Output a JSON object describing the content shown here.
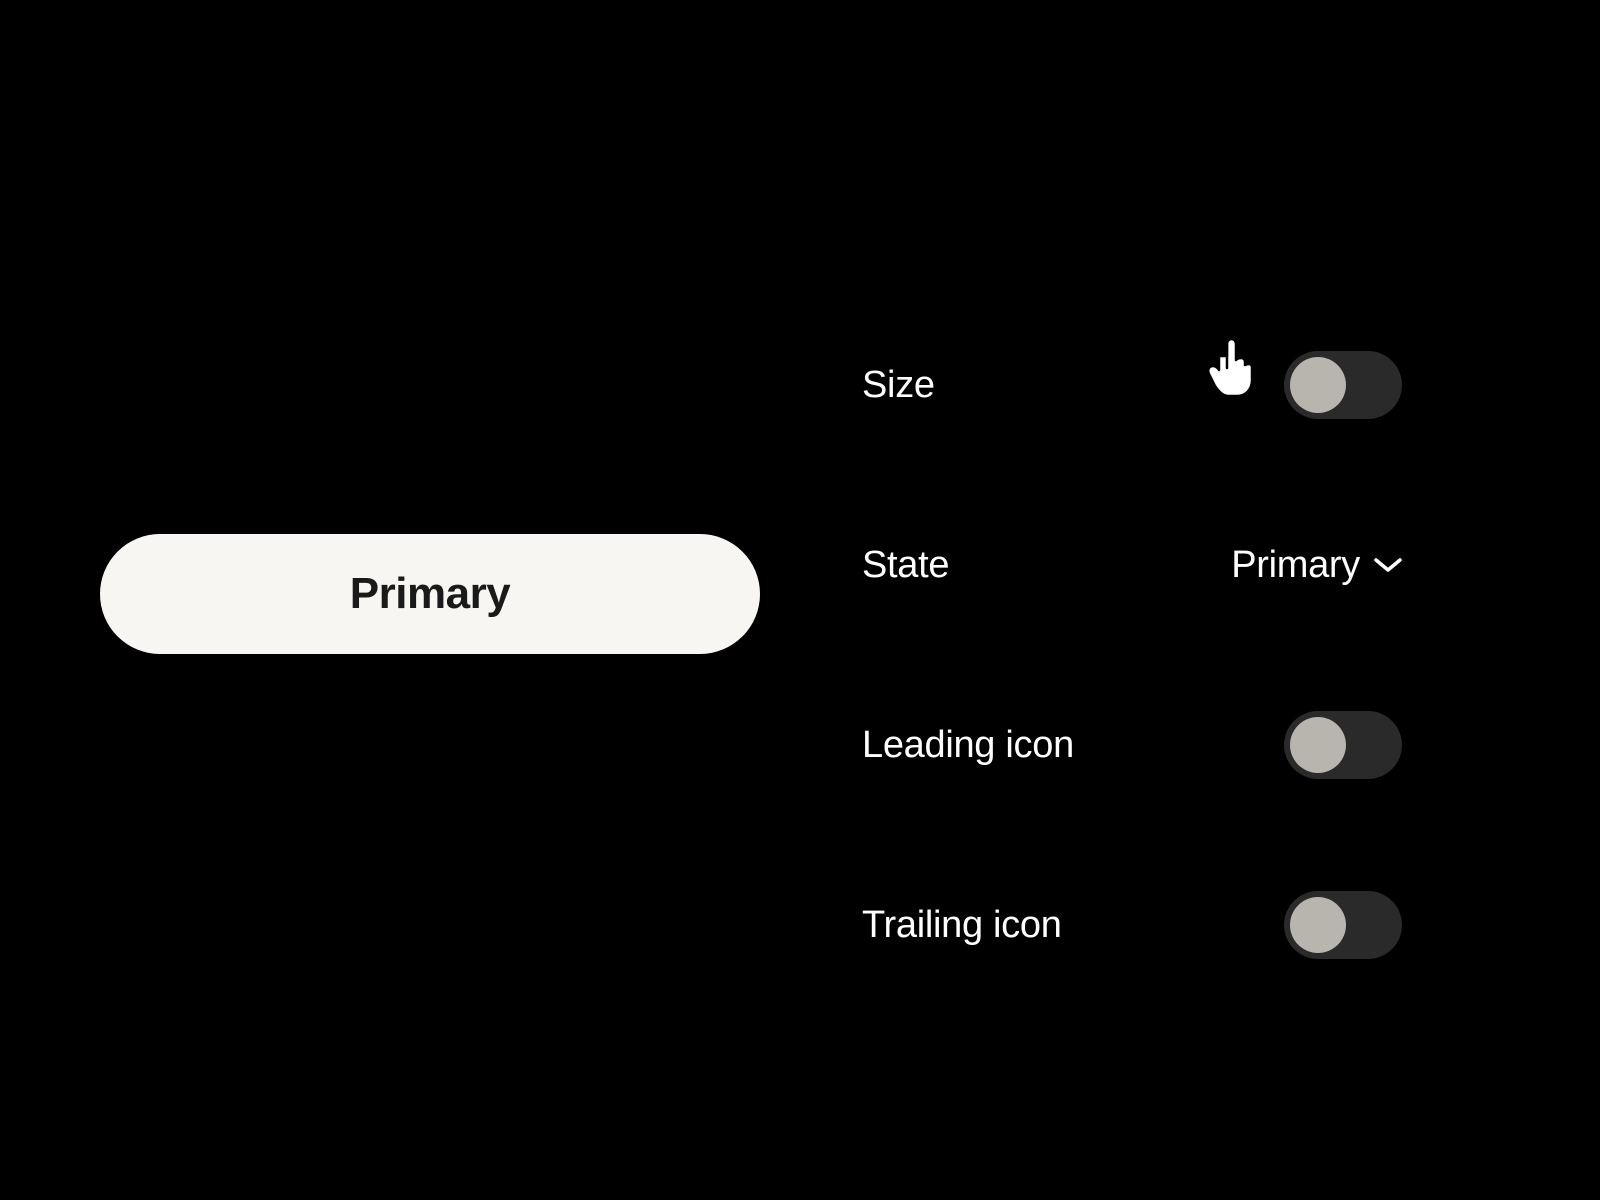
{
  "preview": {
    "button_label": "Primary"
  },
  "controls": {
    "size": {
      "label": "Size",
      "value": false
    },
    "state": {
      "label": "State",
      "selected": "Primary"
    },
    "leading_icon": {
      "label": "Leading icon",
      "value": false
    },
    "trailing_icon": {
      "label": "Trailing icon",
      "value": false
    }
  }
}
